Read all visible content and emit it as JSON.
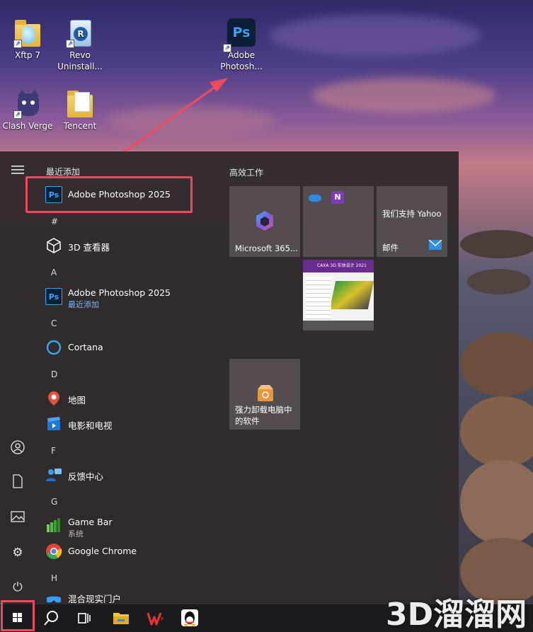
{
  "desktop": {
    "icons": [
      {
        "label_line1": "Xftp 7",
        "label_line2": ""
      },
      {
        "label_line1": "Revo",
        "label_line2": "Uninstall..."
      },
      {
        "label_line1": "Adobe",
        "label_line2": "Photosh..."
      },
      {
        "label_line1": "Clash Verge",
        "label_line2": ""
      },
      {
        "label_line1": "Tencent",
        "label_line2": ""
      }
    ],
    "ps_glyph": "Ps",
    "revo_glyph": "R"
  },
  "start_menu": {
    "recent_title": "最近添加",
    "recent_items": [
      {
        "label": "Adobe Photoshop 2025",
        "icon": "Ps"
      }
    ],
    "letters": [
      "#",
      "A",
      "C",
      "D",
      "F",
      "G",
      "H"
    ],
    "apps": [
      {
        "label": "3D 查看器",
        "sub": ""
      },
      {
        "label": "Adobe Photoshop 2025",
        "sub": "最近添加",
        "icon": "Ps"
      },
      {
        "label": "Cortana",
        "sub": ""
      },
      {
        "label": "地图",
        "sub": ""
      },
      {
        "label": "电影和电视",
        "sub": ""
      },
      {
        "label": "反馈中心",
        "sub": ""
      },
      {
        "label": "Game Bar",
        "sub": "系统"
      },
      {
        "label": "Google Chrome",
        "sub": ""
      },
      {
        "label": "混合现实门户",
        "sub": ""
      }
    ],
    "tiles_title": "高效工作",
    "tiles": [
      {
        "label": "Microsoft 365..."
      },
      {
        "label": ""
      },
      {
        "label": "我们支持 Yahoo",
        "sub": "邮件"
      },
      {
        "label": "CAXA 3D 实体设计 2021"
      },
      {
        "label": "强力卸载电脑中的软件"
      }
    ]
  },
  "watermark": "3D溜溜网",
  "colors": {
    "highlight": "#ef4a5b",
    "ps_blue": "#31a8ff",
    "ps_bg": "#0b1f39"
  }
}
